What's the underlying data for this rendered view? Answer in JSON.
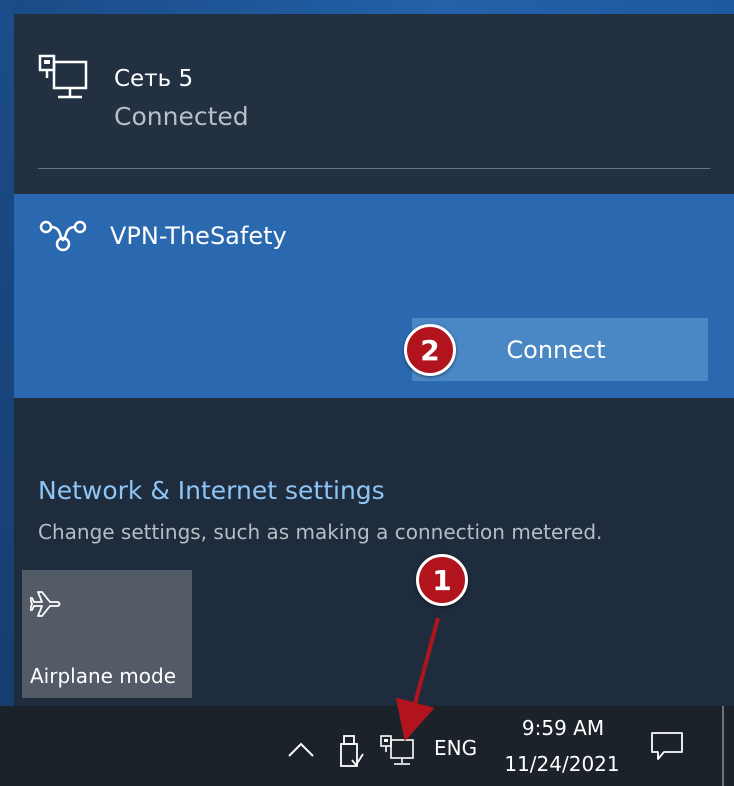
{
  "network": {
    "name": "Сеть 5",
    "status": "Connected",
    "icon": "ethernet-icon"
  },
  "vpn": {
    "name": "VPN-TheSafety",
    "icon": "vpn-icon",
    "connect_label": "Connect"
  },
  "settings": {
    "link": "Network & Internet settings",
    "description": "Change settings, such as making a connection metered."
  },
  "quick_actions": {
    "airplane_mode": "Airplane mode",
    "airplane_icon": "airplane-icon"
  },
  "taskbar": {
    "language": "ENG",
    "time": "9:59 AM",
    "date": "11/24/2021"
  },
  "annotations": {
    "step1": "1",
    "step2": "2",
    "color": "#b1141c"
  },
  "colors": {
    "vpn_selected": "#2a69b0",
    "connect_button": "#4a87c5",
    "link": "#8ec5f4"
  }
}
